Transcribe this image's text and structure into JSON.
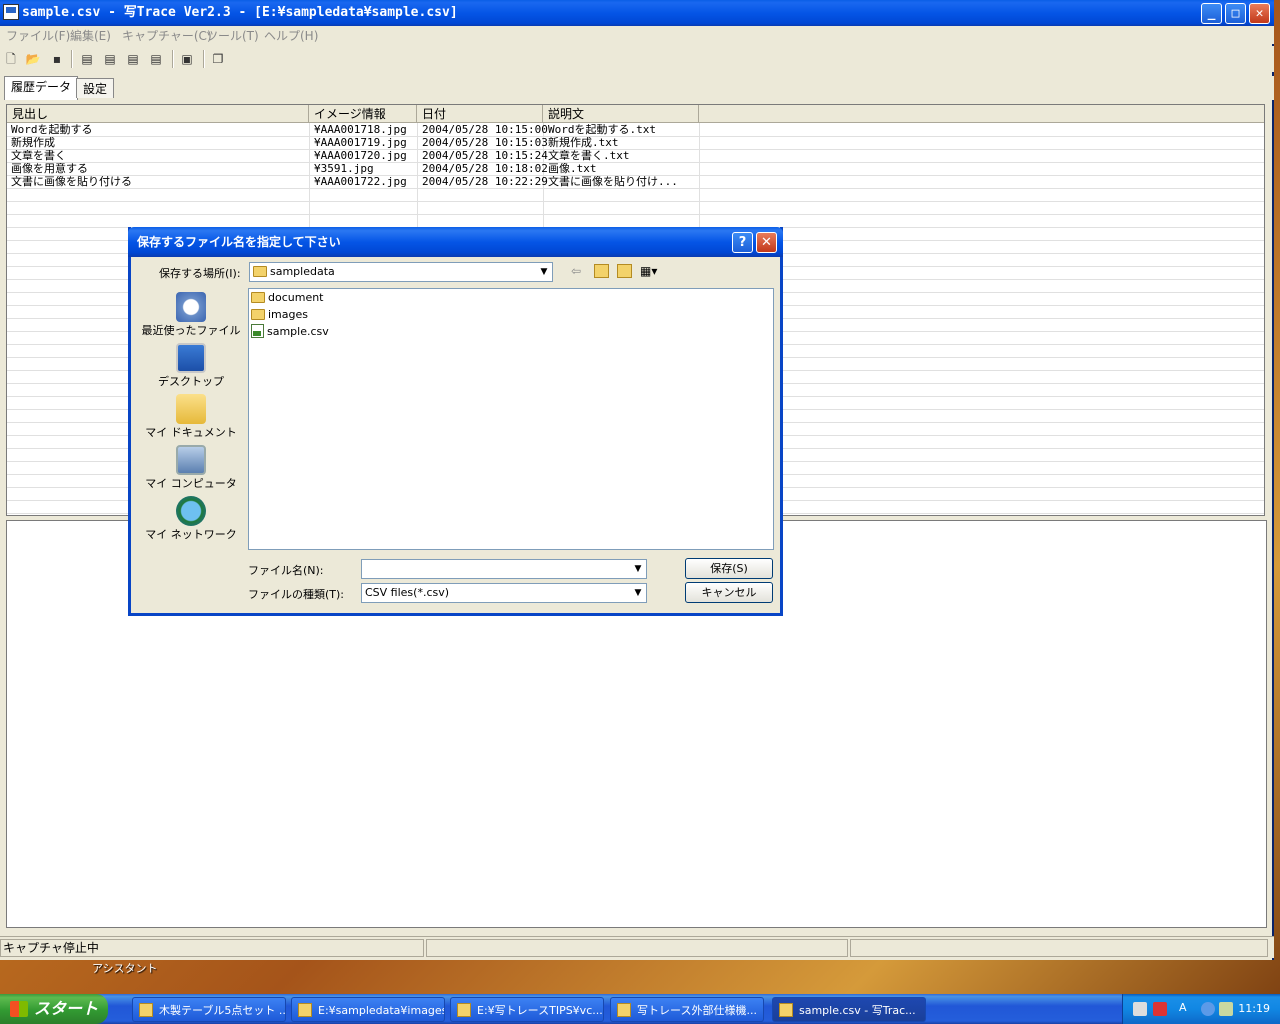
{
  "window": {
    "title": "sample.csv - 写Trace Ver2.3 - [E:¥sampledata¥sample.csv]",
    "controls": {
      "minimize": "_",
      "maximize": "□",
      "close": "✕"
    }
  },
  "menu": [
    "ファイル(F)",
    "編集(E)",
    "キャプチャー(C)",
    "ツール(T)",
    "ヘルプ(H)"
  ],
  "toolbar": [
    "new-file-icon",
    "open-icon",
    "save-icon",
    "list-view-icon-1",
    "list-view-icon-2",
    "list-view-icon-3",
    "list-view-icon-4",
    "capture-window-icon",
    "window-icon"
  ],
  "tabs": [
    {
      "label": "履歴データ",
      "active": true
    },
    {
      "label": "設定",
      "active": false
    }
  ],
  "list": {
    "columns": [
      "見出し",
      "イメージ情報",
      "日付",
      "説明文"
    ],
    "rows": [
      [
        "Wordを起動する",
        "¥AAA001718.jpg",
        "2004/05/28 10:15:00",
        "Wordを起動する.txt"
      ],
      [
        "新規作成",
        "¥AAA001719.jpg",
        "2004/05/28 10:15:03",
        "新規作成.txt"
      ],
      [
        "文章を書く",
        "¥AAA001720.jpg",
        "2004/05/28 10:15:24",
        "文章を書く.txt"
      ],
      [
        "画像を用意する",
        "¥3591.jpg",
        "2004/05/28 10:18:02",
        "画像.txt"
      ],
      [
        "文書に画像を貼り付ける",
        "¥AAA001722.jpg",
        "2004/05/28 10:22:29",
        "文書に画像を貼り付け..."
      ]
    ]
  },
  "status": {
    "capture_state": "キャプチャ停止中"
  },
  "dialog": {
    "title": "保存するファイル名を指定して下さい",
    "help": "?",
    "close": "✕",
    "save_in_label": "保存する場所(I):",
    "save_in_value": "sampledata",
    "places": [
      "最近使ったファイル",
      "デスクトップ",
      "マイ ドキュメント",
      "マイ コンピュータ",
      "マイ ネットワーク"
    ],
    "files": [
      {
        "name": "document",
        "type": "folder"
      },
      {
        "name": "images",
        "type": "folder"
      },
      {
        "name": "sample.csv",
        "type": "csv"
      }
    ],
    "filename_label": "ファイル名(N):",
    "filename_value": "",
    "filetype_label": "ファイルの種類(T):",
    "filetype_value": "CSV files(*.csv)",
    "save_button": "保存(S)",
    "cancel_button": "キャンセル"
  },
  "desktop": {
    "label": "アシスタント"
  },
  "taskbar": {
    "start": "スタート",
    "tasks": [
      {
        "label": "木製テーブル5点セット ...",
        "active": false
      },
      {
        "label": "E:¥sampledata¥images",
        "active": false
      },
      {
        "label": "E:¥写トレースTIPS¥vc...",
        "active": false
      },
      {
        "label": "写トレース外部仕様機...",
        "active": false
      },
      {
        "label": "sample.csv - 写Trac...",
        "active": true
      }
    ],
    "clock": "11:19"
  }
}
